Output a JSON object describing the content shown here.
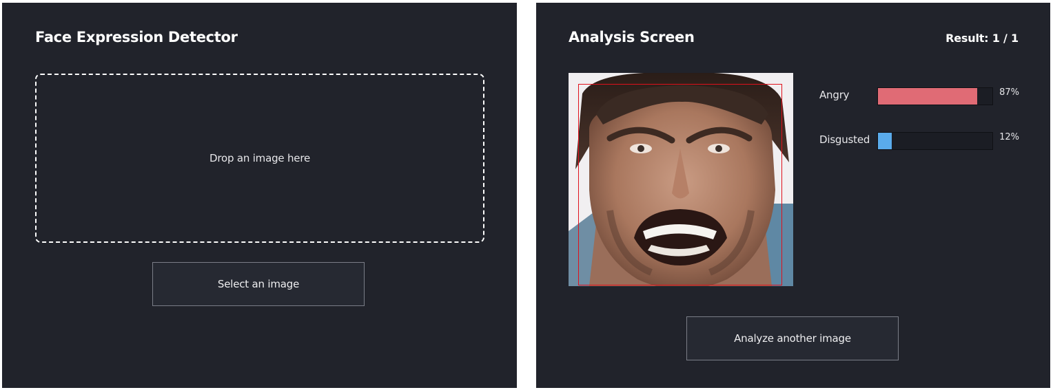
{
  "left_panel": {
    "title": "Face Expression Detector",
    "dropzone_text": "Drop an image here",
    "select_button_label": "Select an image"
  },
  "right_panel": {
    "title": "Analysis Screen",
    "result_text": "Result: 1 / 1",
    "emotions": [
      {
        "label": "Angry",
        "value": 87,
        "value_text": "87%",
        "color": "#e06b75"
      },
      {
        "label": "Disgusted",
        "value": 12,
        "value_text": "12%",
        "color": "#5aabeb"
      }
    ],
    "analyze_button_label": "Analyze another image"
  },
  "colors": {
    "panel_bg": "#21232b",
    "face_box": "#e0101b"
  }
}
